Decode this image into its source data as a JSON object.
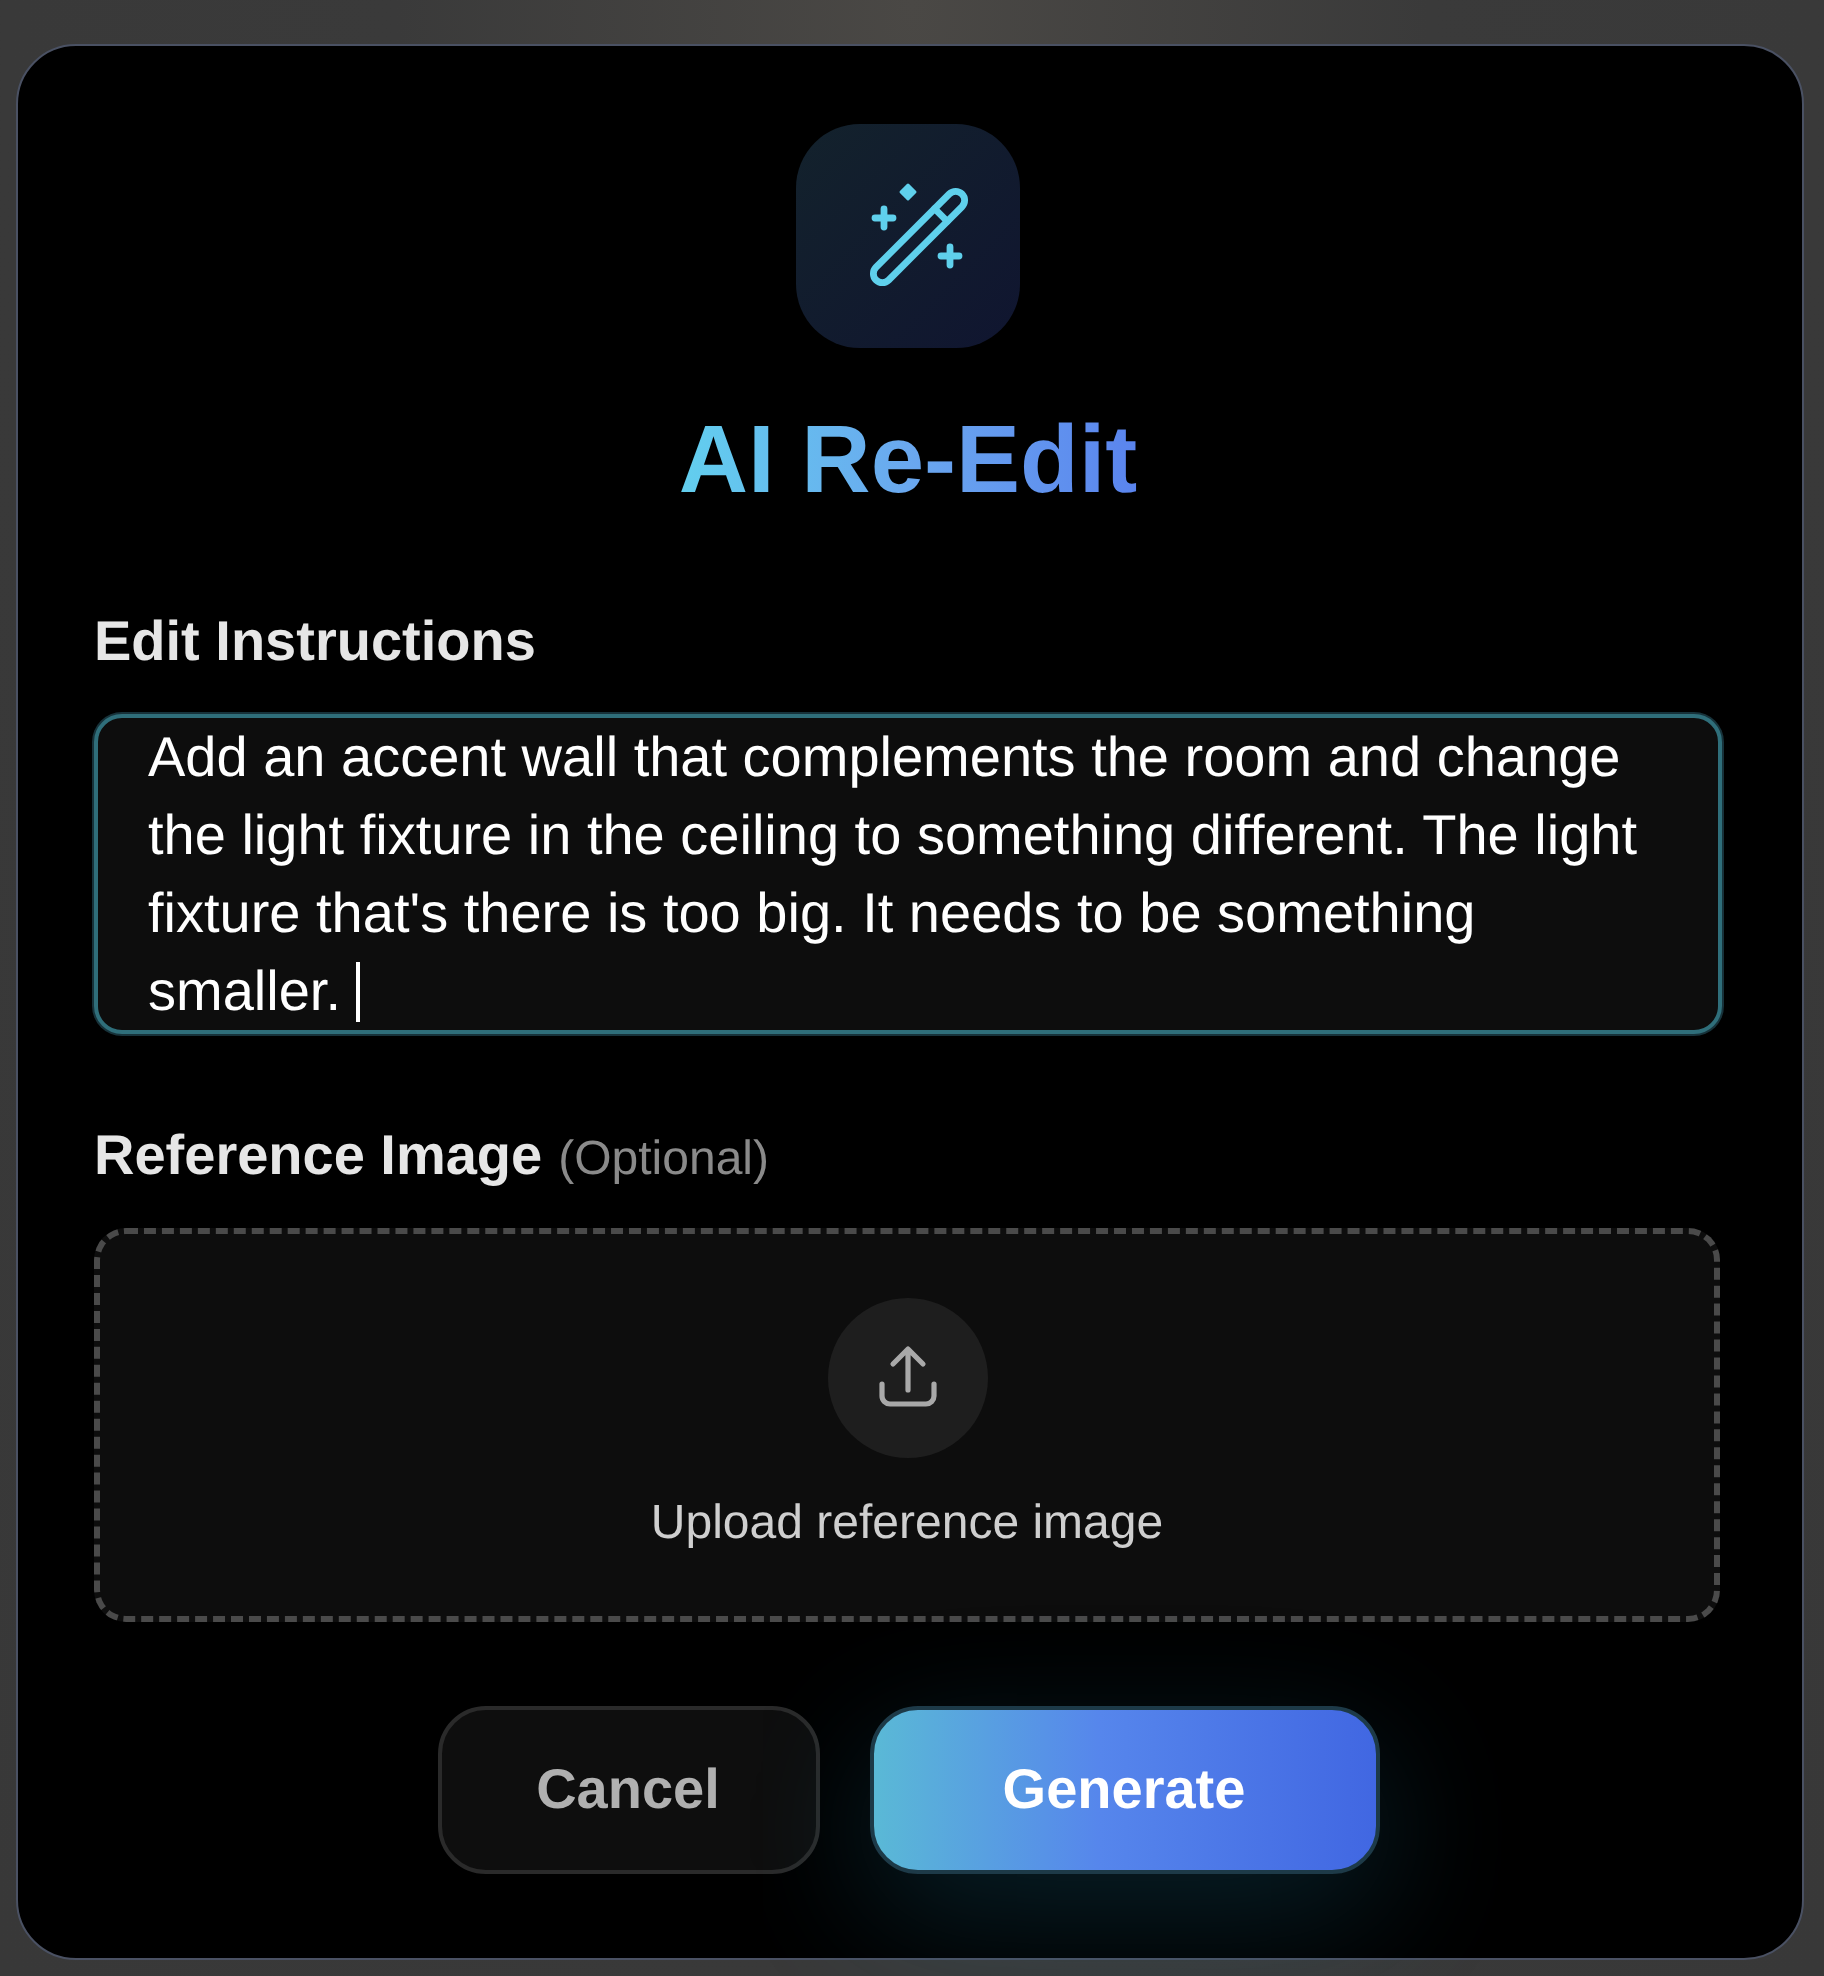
{
  "dialog": {
    "title": "AI Re-Edit"
  },
  "instructions": {
    "label": "Edit Instructions",
    "value": "Add an accent wall that complements the room and change the light fixture in the ceiling to something different. The light fixture that's there is too big. It needs to be something smaller.",
    "focused": true
  },
  "reference": {
    "label": "Reference Image",
    "hint": "(Optional)",
    "upload_text": "Upload reference image"
  },
  "buttons": [
    {
      "label": "Cancel",
      "kind": "secondary"
    },
    {
      "label": "Generate",
      "kind": "primary"
    }
  ]
}
